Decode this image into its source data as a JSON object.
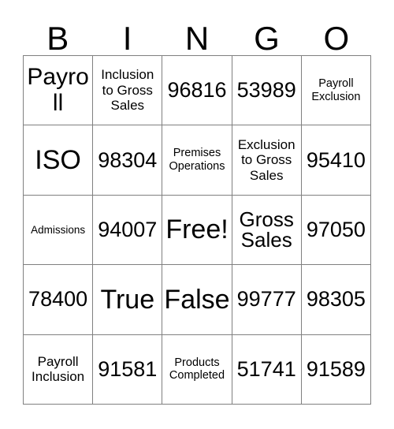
{
  "card": {
    "title": "BINGO Card",
    "columns": [
      "B",
      "I",
      "N",
      "G",
      "O"
    ],
    "rows": [
      [
        {
          "text": "Payroll",
          "size": "lg"
        },
        {
          "text": "Inclusion to Gross Sales",
          "size": "sm"
        },
        {
          "text": "96816",
          "size": "num"
        },
        {
          "text": "53989",
          "size": "num"
        },
        {
          "text": "Payroll Exclusion",
          "size": "xs"
        }
      ],
      [
        {
          "text": "ISO",
          "size": "xl"
        },
        {
          "text": "98304",
          "size": "num"
        },
        {
          "text": "Premises Operations",
          "size": "xs"
        },
        {
          "text": "Exclusion to Gross Sales",
          "size": "sm"
        },
        {
          "text": "95410",
          "size": "num"
        }
      ],
      [
        {
          "text": "Admissions",
          "size": "xxs"
        },
        {
          "text": "94007",
          "size": "num"
        },
        {
          "text": "Free!",
          "size": "xl"
        },
        {
          "text": "Gross Sales",
          "size": "md"
        },
        {
          "text": "97050",
          "size": "num"
        }
      ],
      [
        {
          "text": "78400",
          "size": "num"
        },
        {
          "text": "True",
          "size": "xl"
        },
        {
          "text": "False",
          "size": "xl"
        },
        {
          "text": "99777",
          "size": "num"
        },
        {
          "text": "98305",
          "size": "num"
        }
      ],
      [
        {
          "text": "Payroll Inclusion",
          "size": "sm"
        },
        {
          "text": "91581",
          "size": "num"
        },
        {
          "text": "Products Completed",
          "size": "xs"
        },
        {
          "text": "51741",
          "size": "num"
        },
        {
          "text": "91589",
          "size": "num"
        }
      ]
    ],
    "free_space_label": "Free!",
    "colors": {
      "background": "#ffffff",
      "text": "#000000",
      "grid_line": "#808080"
    }
  }
}
